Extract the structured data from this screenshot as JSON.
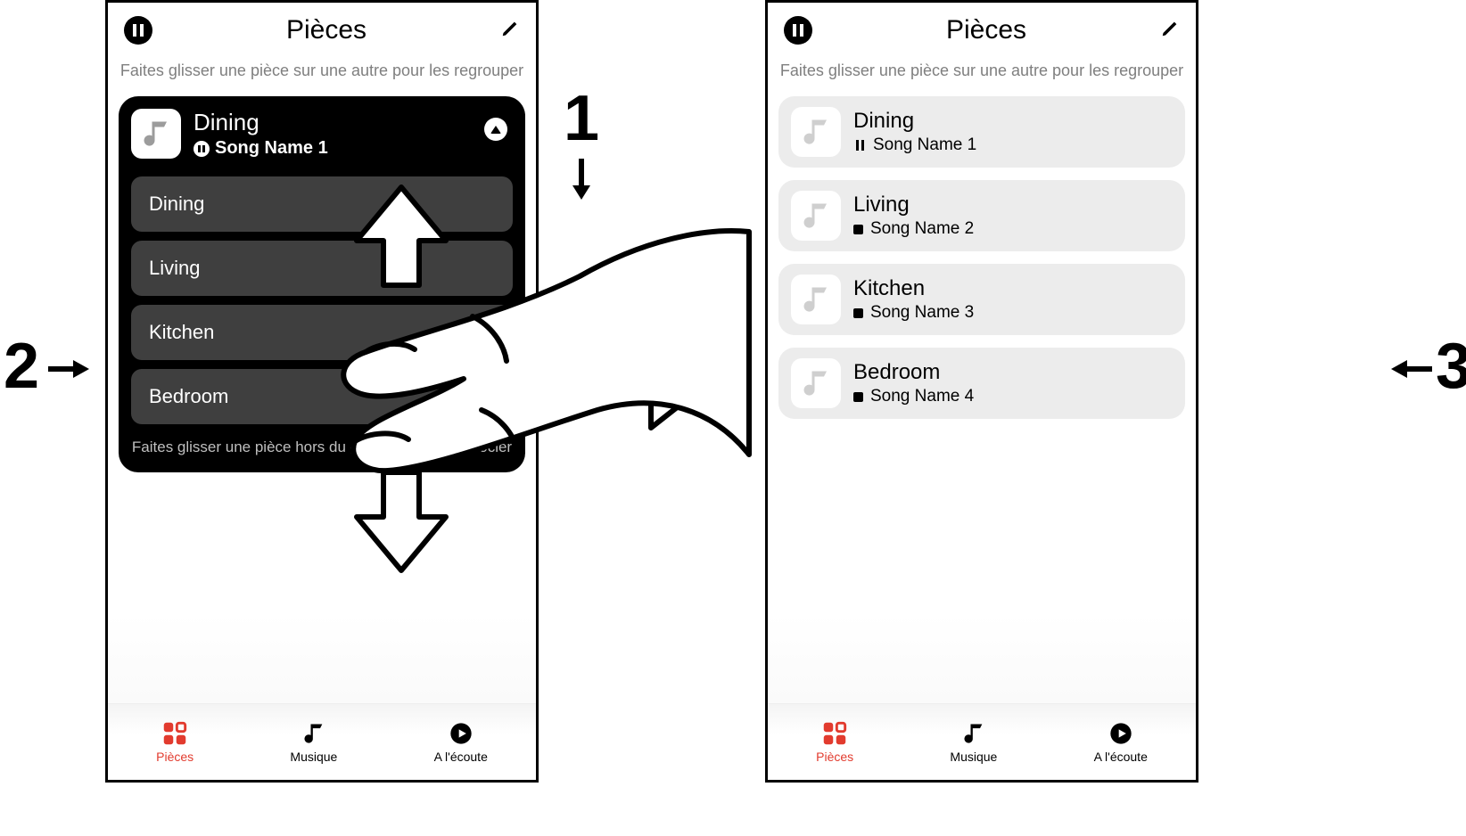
{
  "callouts": {
    "c1": "1",
    "c2": "2",
    "c3": "3"
  },
  "left_phone": {
    "header_title": "Pièces",
    "subtext": "Faites glisser une pièce sur une autre pour les regrouper",
    "card": {
      "title": "Dining",
      "song": "Song Name 1",
      "items": [
        "Dining",
        "Living",
        "Kitchen",
        "Bedroom"
      ],
      "footer": "Faites glisser une pièce hors du groupe pour la dissocier"
    },
    "tabs": {
      "pieces": "Pièces",
      "musique": "Musique",
      "ecoute": "A l'écoute"
    }
  },
  "right_phone": {
    "header_title": "Pièces",
    "subtext": "Faites glisser une pièce sur une autre pour les regrouper",
    "rooms": [
      {
        "name": "Dining",
        "song": "Song Name 1",
        "state": "pause"
      },
      {
        "name": "Living",
        "song": "Song Name 2",
        "state": "stop"
      },
      {
        "name": "Kitchen",
        "song": "Song Name 3",
        "state": "stop"
      },
      {
        "name": "Bedroom",
        "song": "Song Name 4",
        "state": "stop"
      }
    ],
    "tabs": {
      "pieces": "Pièces",
      "musique": "Musique",
      "ecoute": "A l'écoute"
    }
  }
}
